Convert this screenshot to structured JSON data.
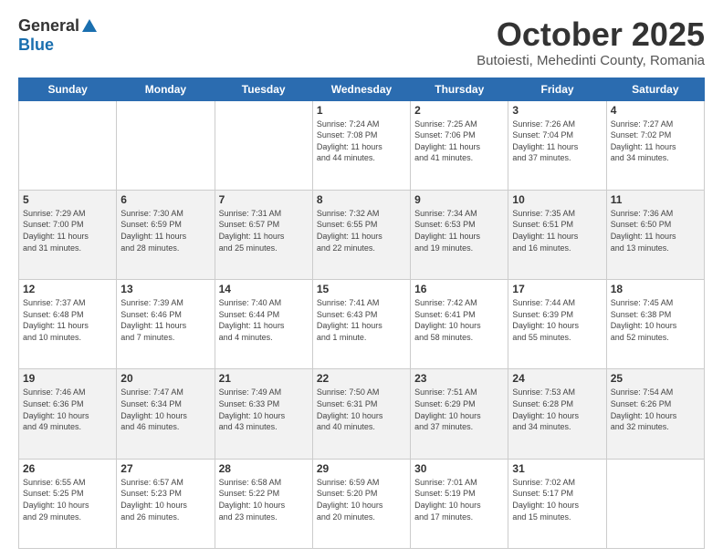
{
  "header": {
    "logo_general": "General",
    "logo_blue": "Blue",
    "month_title": "October 2025",
    "location": "Butoiesti, Mehedinti County, Romania"
  },
  "weekdays": [
    "Sunday",
    "Monday",
    "Tuesday",
    "Wednesday",
    "Thursday",
    "Friday",
    "Saturday"
  ],
  "weeks": [
    [
      {
        "day": "",
        "info": ""
      },
      {
        "day": "",
        "info": ""
      },
      {
        "day": "",
        "info": ""
      },
      {
        "day": "1",
        "info": "Sunrise: 7:24 AM\nSunset: 7:08 PM\nDaylight: 11 hours\nand 44 minutes."
      },
      {
        "day": "2",
        "info": "Sunrise: 7:25 AM\nSunset: 7:06 PM\nDaylight: 11 hours\nand 41 minutes."
      },
      {
        "day": "3",
        "info": "Sunrise: 7:26 AM\nSunset: 7:04 PM\nDaylight: 11 hours\nand 37 minutes."
      },
      {
        "day": "4",
        "info": "Sunrise: 7:27 AM\nSunset: 7:02 PM\nDaylight: 11 hours\nand 34 minutes."
      }
    ],
    [
      {
        "day": "5",
        "info": "Sunrise: 7:29 AM\nSunset: 7:00 PM\nDaylight: 11 hours\nand 31 minutes."
      },
      {
        "day": "6",
        "info": "Sunrise: 7:30 AM\nSunset: 6:59 PM\nDaylight: 11 hours\nand 28 minutes."
      },
      {
        "day": "7",
        "info": "Sunrise: 7:31 AM\nSunset: 6:57 PM\nDaylight: 11 hours\nand 25 minutes."
      },
      {
        "day": "8",
        "info": "Sunrise: 7:32 AM\nSunset: 6:55 PM\nDaylight: 11 hours\nand 22 minutes."
      },
      {
        "day": "9",
        "info": "Sunrise: 7:34 AM\nSunset: 6:53 PM\nDaylight: 11 hours\nand 19 minutes."
      },
      {
        "day": "10",
        "info": "Sunrise: 7:35 AM\nSunset: 6:51 PM\nDaylight: 11 hours\nand 16 minutes."
      },
      {
        "day": "11",
        "info": "Sunrise: 7:36 AM\nSunset: 6:50 PM\nDaylight: 11 hours\nand 13 minutes."
      }
    ],
    [
      {
        "day": "12",
        "info": "Sunrise: 7:37 AM\nSunset: 6:48 PM\nDaylight: 11 hours\nand 10 minutes."
      },
      {
        "day": "13",
        "info": "Sunrise: 7:39 AM\nSunset: 6:46 PM\nDaylight: 11 hours\nand 7 minutes."
      },
      {
        "day": "14",
        "info": "Sunrise: 7:40 AM\nSunset: 6:44 PM\nDaylight: 11 hours\nand 4 minutes."
      },
      {
        "day": "15",
        "info": "Sunrise: 7:41 AM\nSunset: 6:43 PM\nDaylight: 11 hours\nand 1 minute."
      },
      {
        "day": "16",
        "info": "Sunrise: 7:42 AM\nSunset: 6:41 PM\nDaylight: 10 hours\nand 58 minutes."
      },
      {
        "day": "17",
        "info": "Sunrise: 7:44 AM\nSunset: 6:39 PM\nDaylight: 10 hours\nand 55 minutes."
      },
      {
        "day": "18",
        "info": "Sunrise: 7:45 AM\nSunset: 6:38 PM\nDaylight: 10 hours\nand 52 minutes."
      }
    ],
    [
      {
        "day": "19",
        "info": "Sunrise: 7:46 AM\nSunset: 6:36 PM\nDaylight: 10 hours\nand 49 minutes."
      },
      {
        "day": "20",
        "info": "Sunrise: 7:47 AM\nSunset: 6:34 PM\nDaylight: 10 hours\nand 46 minutes."
      },
      {
        "day": "21",
        "info": "Sunrise: 7:49 AM\nSunset: 6:33 PM\nDaylight: 10 hours\nand 43 minutes."
      },
      {
        "day": "22",
        "info": "Sunrise: 7:50 AM\nSunset: 6:31 PM\nDaylight: 10 hours\nand 40 minutes."
      },
      {
        "day": "23",
        "info": "Sunrise: 7:51 AM\nSunset: 6:29 PM\nDaylight: 10 hours\nand 37 minutes."
      },
      {
        "day": "24",
        "info": "Sunrise: 7:53 AM\nSunset: 6:28 PM\nDaylight: 10 hours\nand 34 minutes."
      },
      {
        "day": "25",
        "info": "Sunrise: 7:54 AM\nSunset: 6:26 PM\nDaylight: 10 hours\nand 32 minutes."
      }
    ],
    [
      {
        "day": "26",
        "info": "Sunrise: 6:55 AM\nSunset: 5:25 PM\nDaylight: 10 hours\nand 29 minutes."
      },
      {
        "day": "27",
        "info": "Sunrise: 6:57 AM\nSunset: 5:23 PM\nDaylight: 10 hours\nand 26 minutes."
      },
      {
        "day": "28",
        "info": "Sunrise: 6:58 AM\nSunset: 5:22 PM\nDaylight: 10 hours\nand 23 minutes."
      },
      {
        "day": "29",
        "info": "Sunrise: 6:59 AM\nSunset: 5:20 PM\nDaylight: 10 hours\nand 20 minutes."
      },
      {
        "day": "30",
        "info": "Sunrise: 7:01 AM\nSunset: 5:19 PM\nDaylight: 10 hours\nand 17 minutes."
      },
      {
        "day": "31",
        "info": "Sunrise: 7:02 AM\nSunset: 5:17 PM\nDaylight: 10 hours\nand 15 minutes."
      },
      {
        "day": "",
        "info": ""
      }
    ]
  ]
}
